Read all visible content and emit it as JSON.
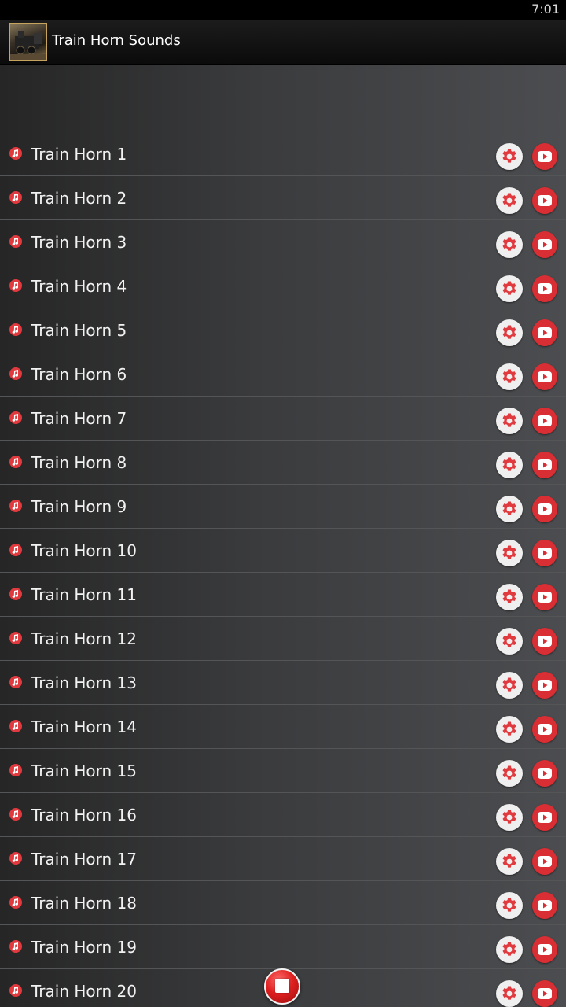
{
  "status_bar": {
    "time": "7:01"
  },
  "action_bar": {
    "title": "Train Horn Sounds",
    "icon": "train-locomotive-icon"
  },
  "sounds": [
    {
      "label": "Train Horn 1"
    },
    {
      "label": "Train Horn 2"
    },
    {
      "label": "Train Horn 3"
    },
    {
      "label": "Train Horn 4"
    },
    {
      "label": "Train Horn 5"
    },
    {
      "label": "Train Horn 6"
    },
    {
      "label": "Train Horn 7"
    },
    {
      "label": "Train Horn 8"
    },
    {
      "label": "Train Horn 9"
    },
    {
      "label": "Train Horn 10"
    },
    {
      "label": "Train Horn 11"
    },
    {
      "label": "Train Horn 12"
    },
    {
      "label": "Train Horn 13"
    },
    {
      "label": "Train Horn 14"
    },
    {
      "label": "Train Horn 15"
    },
    {
      "label": "Train Horn 16"
    },
    {
      "label": "Train Horn 17"
    },
    {
      "label": "Train Horn 18"
    },
    {
      "label": "Train Horn 19"
    },
    {
      "label": "Train Horn 20"
    }
  ],
  "icons": {
    "row_leading": "music-note-icon",
    "settings": "gear-icon",
    "video": "youtube-play-icon",
    "floating": "stop-icon"
  },
  "colors": {
    "accent_red": "#e0393e",
    "action_bar": "#111111",
    "text": "#f2f2f2"
  }
}
